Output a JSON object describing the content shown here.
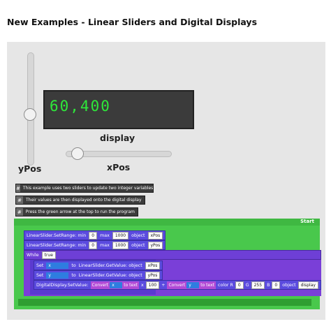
{
  "page": {
    "title": "New Examples - Linear Sliders and Digital Displays"
  },
  "sliders": {
    "ypos_label": "yPos",
    "xpos_label": "xPos",
    "ypos_value_fraction": 0.5,
    "xpos_value_fraction": 0.1
  },
  "display": {
    "label": "display",
    "value": "60,400",
    "color": "#2ee83a"
  },
  "comments": [
    "This example uses two sliders to update two integer variables",
    "Their values are then displayed onto the digital display",
    "Press the green arrow at the top to run the program"
  ],
  "program": {
    "start_label": "Start",
    "setrange1": {
      "fn": "LinearSlider.SetRange: min",
      "min": "0",
      "max_label": "max",
      "max": "1000",
      "object_label": "object",
      "object": "xPos"
    },
    "setrange2": {
      "fn": "LinearSlider.SetRange: min",
      "min": "0",
      "max_label": "max",
      "max": "1000",
      "object_label": "object",
      "object": "yPos"
    },
    "while": {
      "label": "While",
      "cond": "true"
    },
    "set1": {
      "set": "Set",
      "var": "x",
      "to": "to",
      "fn": "LinearSlider.GetValue: object",
      "object": "xPos"
    },
    "set2": {
      "set": "Set",
      "var": "y",
      "to": "to",
      "fn": "LinearSlider.GetValue: object",
      "object": "yPos"
    },
    "setvalue": {
      "fn": "DigitalDisplay.SetValue:",
      "convert1": "Convert",
      "var1": "x",
      "to_text1": "to text",
      "mult": "x",
      "const": "100",
      "plus": "+",
      "convert2": "Convert",
      "var2": "y",
      "to_text2": "to text",
      "color_label": "color R",
      "r": "0",
      "g_label": "G",
      "g": "255",
      "b_label": "B",
      "b": "0",
      "object_label": "object",
      "object": "display"
    }
  }
}
